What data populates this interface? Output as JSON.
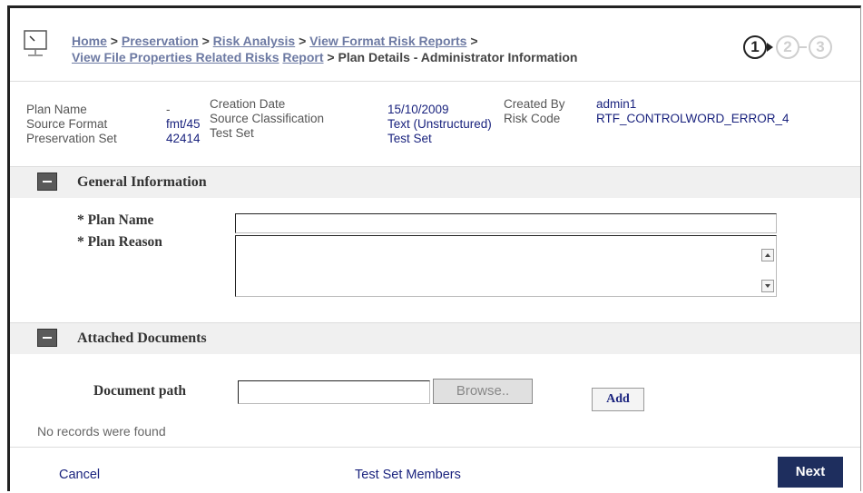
{
  "breadcrumb": {
    "home": "Home",
    "preservation": "Preservation",
    "risk_analysis": "Risk Analysis",
    "view_format_risk_reports": "View Format Risk Reports",
    "view_file_properties": "View File Properties Related Risks",
    "report": "Report",
    "current": "Plan Details - Administrator Information",
    "separator": ">"
  },
  "steps": [
    "1",
    "2",
    "3"
  ],
  "info": {
    "plan_name_label": "Plan Name",
    "plan_name_value": "-",
    "source_format_label": "Source Format",
    "source_format_value": "fmt/45",
    "preservation_set_label": "Preservation Set",
    "preservation_set_value": "42414",
    "creation_date_label": "Creation Date",
    "creation_date_value": "15/10/2009",
    "source_classification_label": "Source Classification",
    "source_classification_value": "Text (Unstructured)",
    "test_set_label": "Test Set",
    "test_set_value": "Test Set",
    "created_by_label": "Created By",
    "created_by_value": "admin1",
    "risk_code_label": "Risk Code",
    "risk_code_value": "RTF_CONTROLWORD_ERROR_4"
  },
  "general": {
    "title": "General Information",
    "plan_name_label": "* Plan Name",
    "plan_name_value": "",
    "plan_reason_label": "* Plan Reason",
    "plan_reason_value": ""
  },
  "attached": {
    "title": "Attached Documents",
    "document_path_label": "Document path",
    "document_path_value": "",
    "browse_label": "Browse..",
    "add_label": "Add",
    "empty_message": "No records were found"
  },
  "footer": {
    "cancel_label": "Cancel",
    "members_label": "Test Set Members",
    "next_label": "Next"
  }
}
